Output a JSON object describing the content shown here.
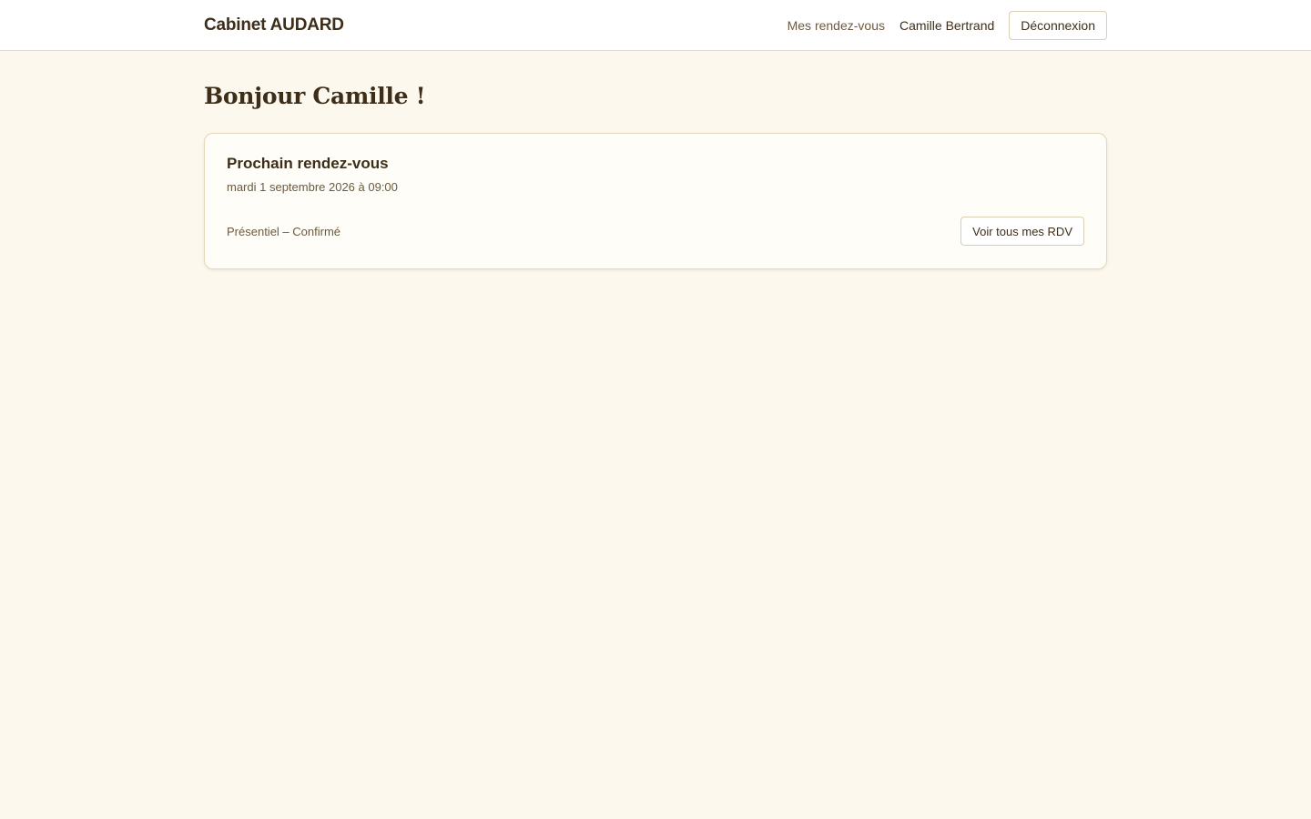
{
  "header": {
    "brand": "Cabinet AUDARD",
    "nav_link": "Mes rendez-vous",
    "user_name": "Camille Bertrand",
    "logout_label": "Déconnexion"
  },
  "main": {
    "greeting": "Bonjour Camille !",
    "next_appointment": {
      "title": "Prochain rendez-vous",
      "datetime": "mardi 1 septembre 2026 à 09:00",
      "status": "Présentiel – Confirmé",
      "view_all_label": "Voir tous mes RDV"
    }
  },
  "colors": {
    "background": "#fdf8ed",
    "text": "#3d2e1a",
    "muted_text": "#6b5a3f",
    "border": "#e3d8b8"
  }
}
